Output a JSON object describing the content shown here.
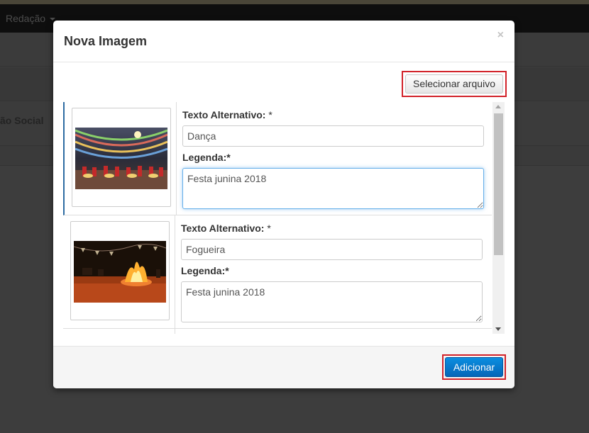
{
  "background": {
    "nav_item": "Redação",
    "row_text": "ão Social"
  },
  "modal": {
    "title": "Nova Imagem",
    "close": "×",
    "select_file_label": "Selecionar arquivo",
    "add_label": "Adicionar"
  },
  "images": [
    {
      "alt_label": "Texto Alternativo:",
      "required_mark": " *",
      "alt_value": "Dança",
      "caption_label": "Legenda:*",
      "caption_value": "Festa junina 2018"
    },
    {
      "alt_label": "Texto Alternativo:",
      "required_mark": " *",
      "alt_value": "Fogueira",
      "caption_label": "Legenda:*",
      "caption_value": "Festa junina 2018"
    }
  ],
  "colors": {
    "highlight": "#d2232a",
    "primary": "#0a7fd5",
    "focus": "#66afe9"
  }
}
